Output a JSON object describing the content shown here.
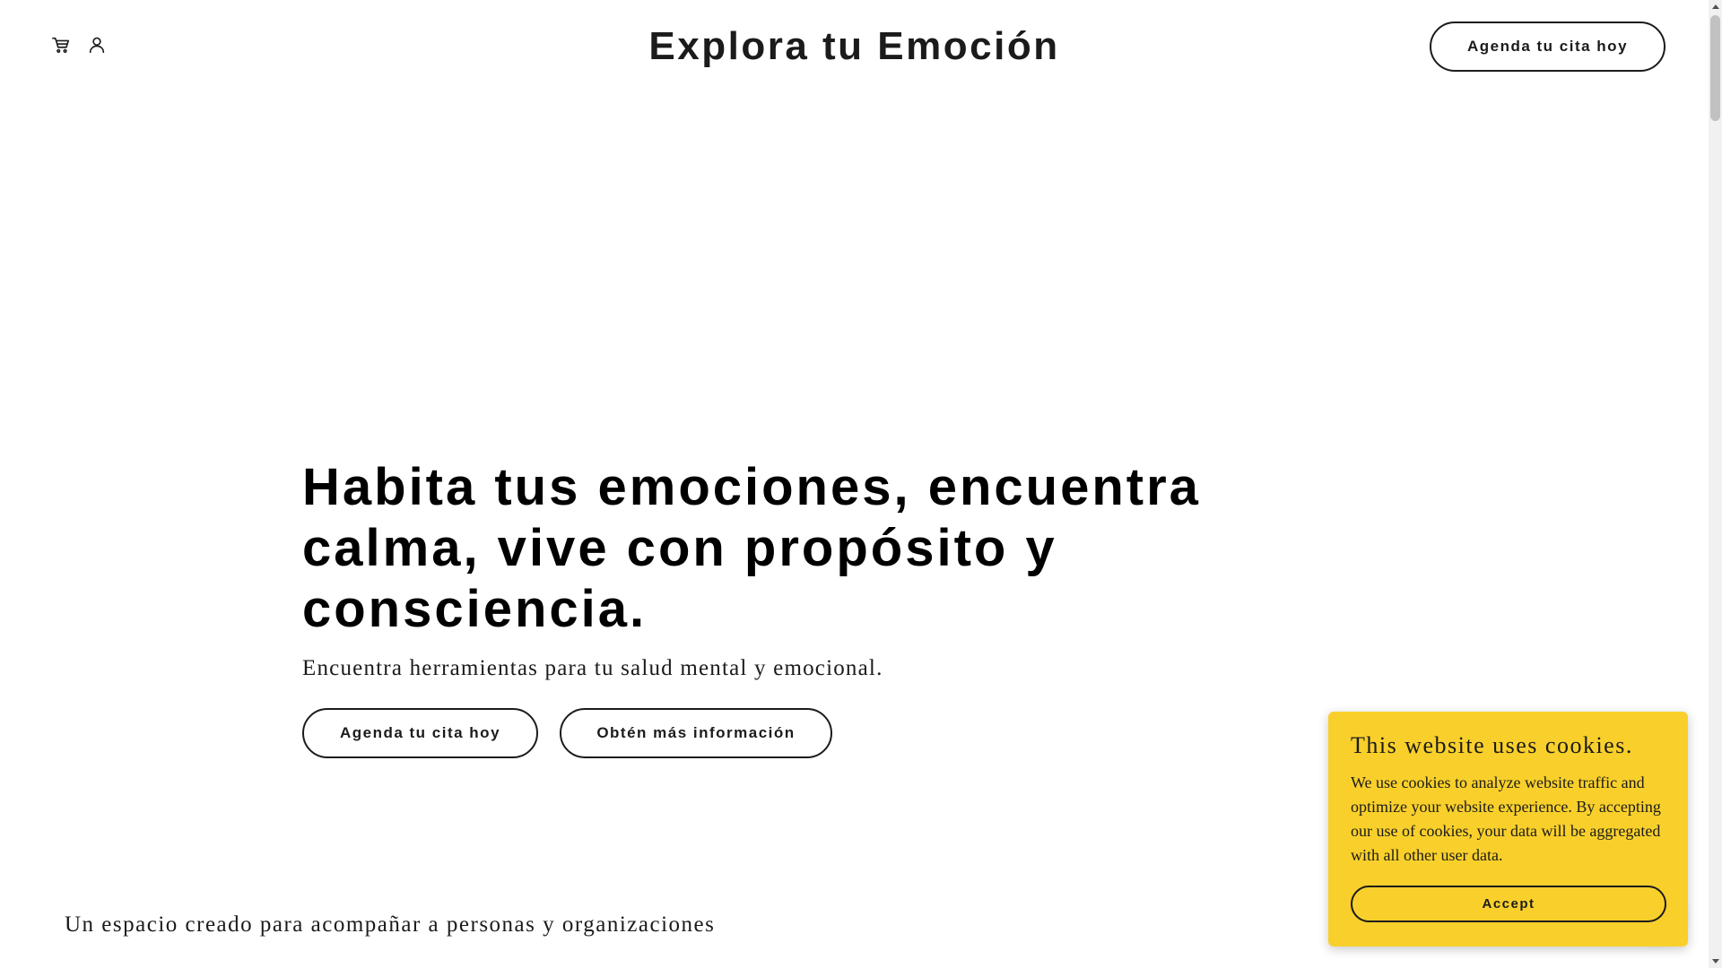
{
  "header": {
    "title": "Explora tu Emoción",
    "cta_label": "Agenda tu cita hoy",
    "icons": [
      "cart-icon",
      "user-icon"
    ]
  },
  "hero": {
    "title": "Habita tus emociones, encuentra calma, vive con propósito y consciencia.",
    "subtitle": "Encuentra herramientas para tu salud mental y emocional.",
    "primary_button": "Agenda tu cita hoy",
    "secondary_button": "Obtén más información"
  },
  "section": {
    "tagline": "Un espacio creado para acompañar a personas y organizaciones"
  },
  "cookie_banner": {
    "title": "This website uses cookies.",
    "body": "We use cookies to analyze website traffic and optimize your website experience. By accepting our use of cookies, your data will be aggregated with all other user data.",
    "accept_label": "Accept",
    "background_color": "#f9d02b"
  }
}
